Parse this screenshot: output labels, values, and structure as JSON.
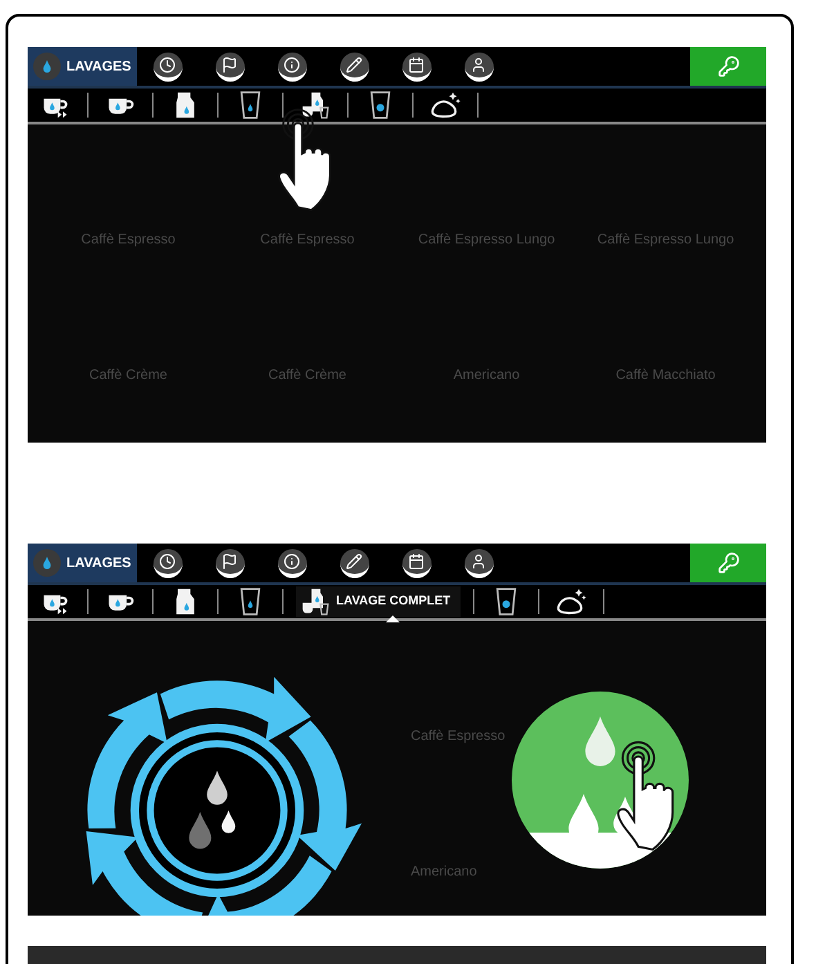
{
  "screens": [
    {
      "kind": "tool_touch",
      "header": {
        "title": "LAVAGES"
      },
      "tools": [
        {
          "selected": false
        },
        {
          "selected": false
        },
        {
          "selected": false
        },
        {
          "selected": false
        },
        {
          "selected": false
        },
        {
          "selected": false
        },
        {
          "selected": false
        }
      ],
      "products": [
        {
          "label": "Caffè Espresso"
        },
        {
          "label": "Caffè Espresso"
        },
        {
          "label": "Caffè Espresso Lungo"
        },
        {
          "label": "Caffè Espresso Lungo"
        },
        {
          "label": "Caffè Crème"
        },
        {
          "label": "Caffè Crème"
        },
        {
          "label": "Americano"
        },
        {
          "label": "Caffè Macchiato"
        }
      ]
    },
    {
      "kind": "wash_confirm",
      "header": {
        "title": "LAVAGES"
      },
      "tools": [
        {
          "selected": false
        },
        {
          "selected": false
        },
        {
          "selected": false
        },
        {
          "selected": false
        },
        {
          "selected": true,
          "label": "LAVAGE COMPLET"
        },
        {
          "selected": false
        },
        {
          "selected": false
        }
      ],
      "products": [
        {
          "label": "Caffè Espresso"
        },
        {
          "label": "Americano"
        }
      ]
    }
  ]
}
